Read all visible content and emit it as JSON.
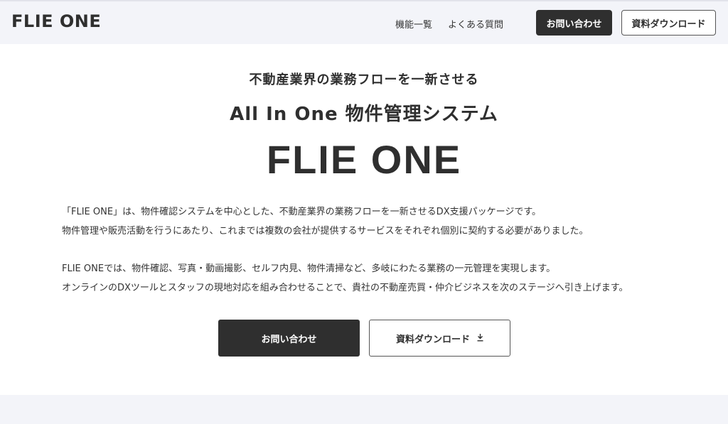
{
  "header": {
    "logo": "FLIE ONE",
    "nav": {
      "features": "機能一覧",
      "faq": "よくある質問"
    },
    "contact_button": "お問い合わせ",
    "download_button": "資料ダウンロード"
  },
  "hero": {
    "tagline": "不動産業界の業務フローを一新させる",
    "subtitle": "All In One 物件管理システム",
    "product_name": "FLIE ONE",
    "description": [
      "「FLIE ONE」は、物件確認システムを中心とした、不動産業界の業務フローを一新させるDX支援パッケージです。",
      "物件管理や販売活動を行うにあたり、これまでは複数の会社が提供するサービスをそれぞれ個別に契約する必要がありました。",
      "FLIE ONEでは、物件確認、写真・動画撮影、セルフ内見、物件清掃など、多岐にわたる業務の一元管理を実現します。",
      "オンラインのDXツールとスタッフの現地対応を組み合わせることで、貴社の不動産売買・仲介ビジネスを次のステージへ引き上げます。"
    ],
    "cta_contact": "お問い合わせ",
    "cta_download": "資料ダウンロード",
    "download_icon": "download-icon"
  },
  "colors": {
    "header_bg": "#f3f4f9",
    "primary_dark": "#2f2f2f",
    "text": "#333333"
  }
}
